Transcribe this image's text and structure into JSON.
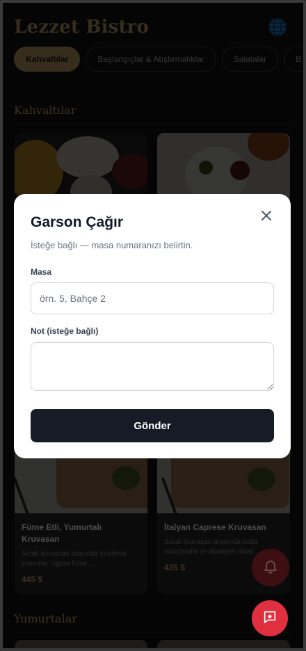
{
  "header": {
    "brand": "Lezzet Bistro",
    "language_icon": "globe-icon"
  },
  "tabs": [
    {
      "label": "Kahvaltılar",
      "active": true
    },
    {
      "label": "Başlangıçlar & Atıştırmalıklar",
      "active": false
    },
    {
      "label": "Salatalar",
      "active": false
    },
    {
      "label": "B",
      "active": false
    }
  ],
  "sections": [
    {
      "title": "Kahvaltılar"
    },
    {
      "title": "Yumurtalar"
    }
  ],
  "cards": [
    {
      "name": "Füme Etli, Yumurtalı Kruvasan",
      "desc": "Sıcak kruvasan arasında çırpılmış yumurta, ızgara füme ...",
      "price": "445 $"
    },
    {
      "name": "İtalyan Caprese Kruvasan",
      "desc": "Sıcak kruvasan arasında suda mozzarella ve domates dilimi...",
      "price": "435 $"
    }
  ],
  "fabs": {
    "bell_icon": "bell-icon",
    "call_icon": "waiter-call-icon"
  },
  "modal": {
    "title": "Garson Çağır",
    "subtitle": "İsteğe bağlı — masa numaranızı belirtin.",
    "table_label": "Masa",
    "table_placeholder": "örn. 5, Bahçe 2",
    "table_value": "",
    "note_label": "Not (isteğe bağlı)",
    "note_value": "",
    "submit_label": "Gönder",
    "close_icon": "close-icon"
  },
  "colors": {
    "brand": "#c9a36b",
    "background": "#0b0b0b",
    "modal_bg": "#ffffff",
    "submit_bg": "#161b26",
    "fab_red": "#e0303f"
  }
}
